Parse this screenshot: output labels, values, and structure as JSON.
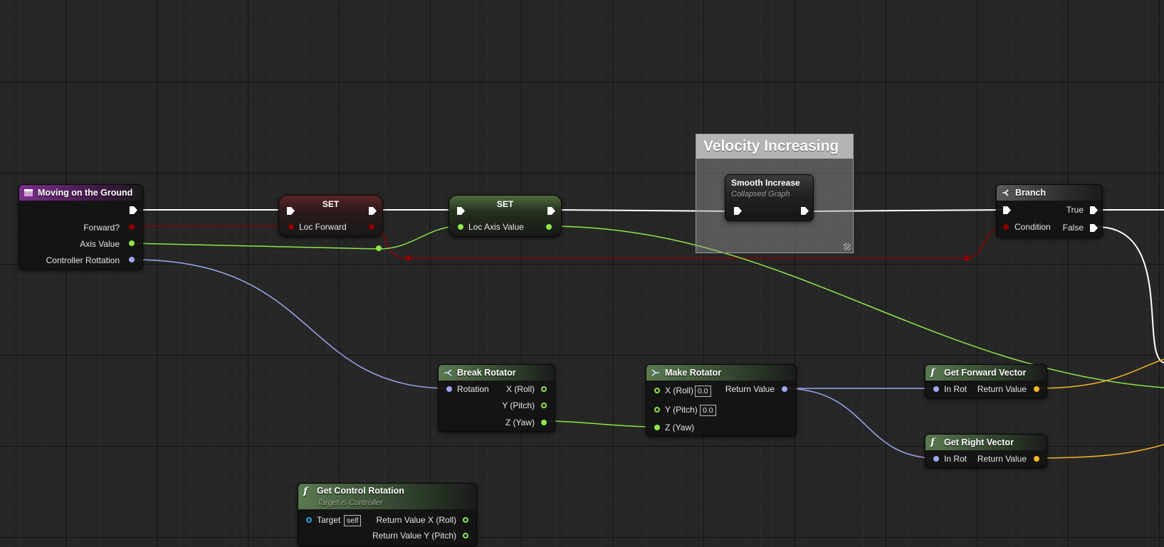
{
  "colors": {
    "exec": "#ffffff",
    "bool": "#8c0000",
    "float": "#8ee64b",
    "rotator": "#9ca7ee",
    "vector": "#f5b428",
    "object": "#1aa3e0"
  },
  "comment": {
    "title": "Velocity Increasing"
  },
  "nodes": {
    "moving": {
      "title": "Moving on the Ground",
      "pins": {
        "forward": "Forward?",
        "axis_value": "Axis Value",
        "controller_rotation": "Controller Rottation"
      }
    },
    "set_forward": {
      "title": "SET",
      "var": "Loc Forward"
    },
    "set_axis": {
      "title": "SET",
      "var": "Loc Axis Value"
    },
    "smooth": {
      "title": "Smooth Increase",
      "subtitle": "Collapsed Graph"
    },
    "branch": {
      "title": "Branch",
      "condition": "Condition",
      "true": "True",
      "false": "False"
    },
    "break_rot": {
      "title": "Break Rotator",
      "rotation": "Rotation",
      "x": "X (Roll)",
      "y": "Y (Pitch)",
      "z": "Z (Yaw)"
    },
    "make_rot": {
      "title": "Make Rotator",
      "x": "X (Roll)",
      "y": "Y (Pitch)",
      "z": "Z (Yaw)",
      "x_val": "0.0",
      "y_val": "0.0",
      "ret": "Return Value"
    },
    "fwd_vec": {
      "title": "Get Forward Vector",
      "in": "In Rot",
      "ret": "Return Value"
    },
    "right_vec": {
      "title": "Get Right Vector",
      "in": "In Rot",
      "ret": "Return Value"
    },
    "ctrl_rot": {
      "title": "Get Control Rotation",
      "subtitle": "Target is Controller",
      "target": "Target",
      "target_val": "self",
      "ret_x": "Return Value X (Roll)",
      "ret_y": "Return Value Y (Pitch)"
    }
  }
}
